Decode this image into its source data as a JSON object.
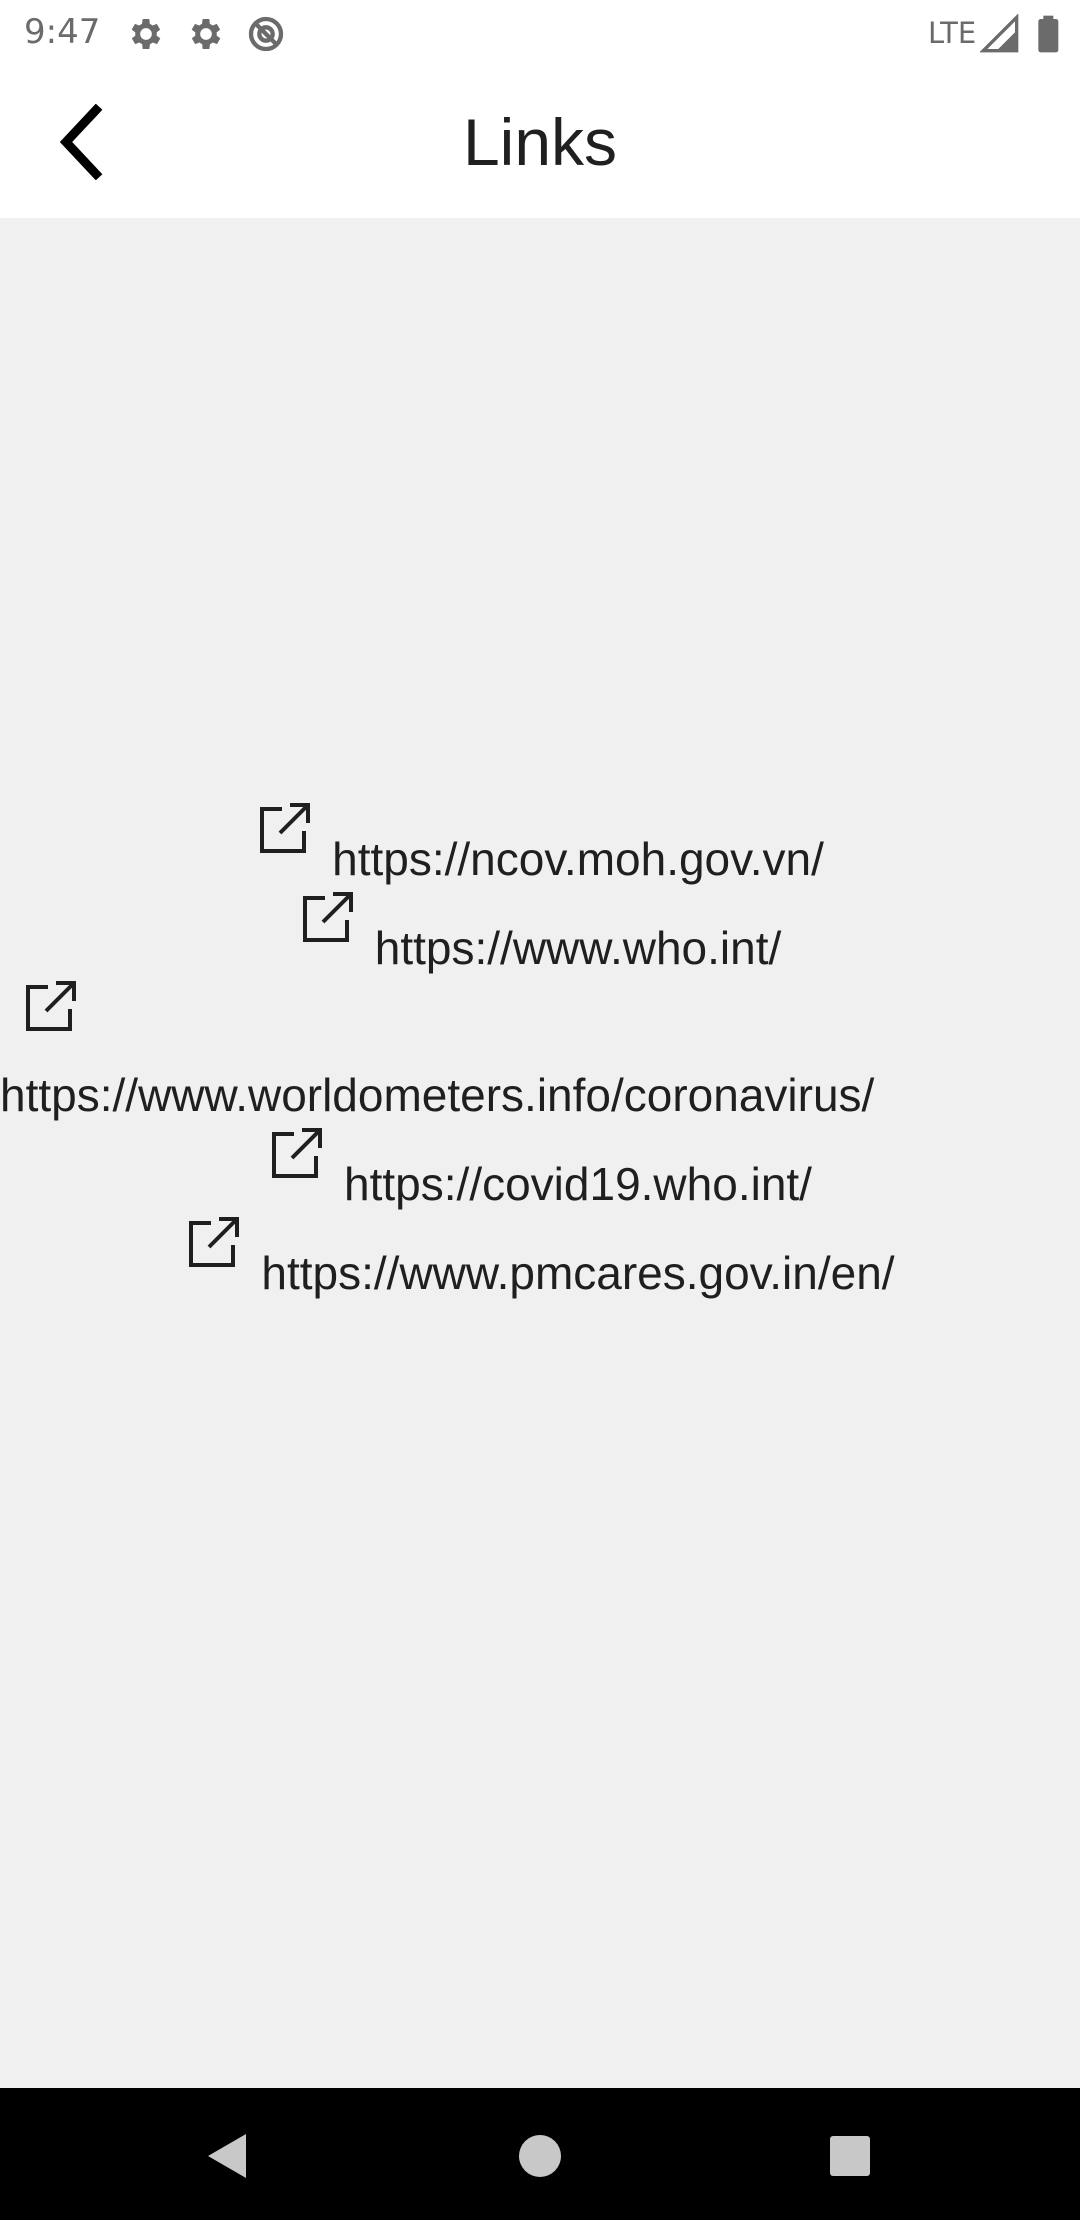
{
  "status_bar": {
    "time": "9:47",
    "network": "LTE",
    "icons": [
      "gear-icon",
      "gear-icon",
      "sync-icon",
      "signal-icon",
      "battery-icon"
    ]
  },
  "app_bar": {
    "title": "Links",
    "back_icon": "chevron-left-icon"
  },
  "links": [
    {
      "url": "https://ncov.moh.gov.vn/",
      "icon": "external-link-icon"
    },
    {
      "url": "https://www.who.int/",
      "icon": "external-link-icon"
    },
    {
      "url": "https://www.worldometers.info/coronavirus/",
      "icon": "external-link-icon"
    },
    {
      "url": "https://covid19.who.int/",
      "icon": "external-link-icon"
    },
    {
      "url": "https://www.pmcares.gov.in/en/",
      "icon": "external-link-icon"
    }
  ],
  "nav_bar": {
    "items": [
      "back-triangle-icon",
      "home-circle-icon",
      "recents-square-icon"
    ]
  },
  "colors": {
    "background": "#f0f0f0",
    "app_bar": "#ffffff",
    "text": "#1f1f1f",
    "nav_bar": "#000000"
  }
}
